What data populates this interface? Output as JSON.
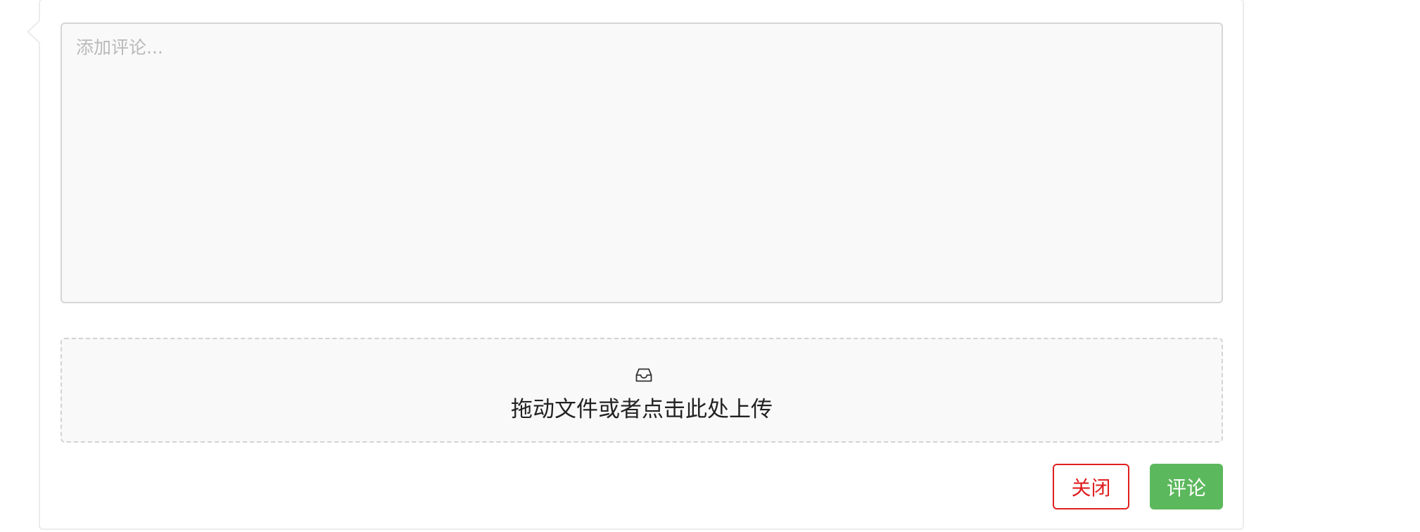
{
  "comment": {
    "placeholder": "添加评论...",
    "value": ""
  },
  "upload": {
    "icon": "inbox-icon",
    "text": "拖动文件或者点击此处上传"
  },
  "actions": {
    "close_label": "关闭",
    "submit_label": "评论"
  },
  "colors": {
    "close": "#e02020",
    "submit": "#5cb85c",
    "border": "#d6d6d6",
    "field_bg": "#f9f9f9"
  }
}
